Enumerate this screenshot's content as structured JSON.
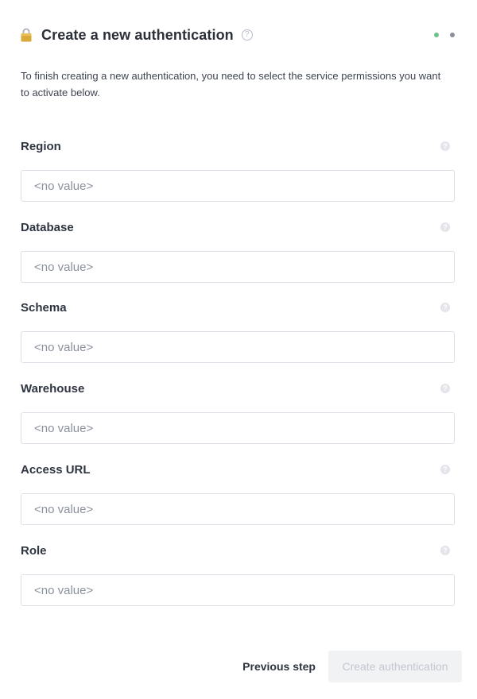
{
  "header": {
    "title": "Create a new authentication",
    "lock_icon": "lock-icon",
    "help_icon": "question-circle-icon",
    "steps": [
      {
        "state": "done",
        "color": "#6cc28a"
      },
      {
        "state": "current",
        "color": "#8a8f99"
      }
    ]
  },
  "description": "To finish creating a new authentication, you need to select the service permissions you want to activate below.",
  "fields": [
    {
      "label": "Region",
      "placeholder": "<no value>",
      "value": ""
    },
    {
      "label": "Database",
      "placeholder": "<no value>",
      "value": ""
    },
    {
      "label": "Schema",
      "placeholder": "<no value>",
      "value": ""
    },
    {
      "label": "Warehouse",
      "placeholder": "<no value>",
      "value": ""
    },
    {
      "label": "Access URL",
      "placeholder": "<no value>",
      "value": ""
    },
    {
      "label": "Role",
      "placeholder": "<no value>",
      "value": ""
    }
  ],
  "footer": {
    "previous_label": "Previous step",
    "create_label": "Create authentication",
    "create_enabled": false
  }
}
